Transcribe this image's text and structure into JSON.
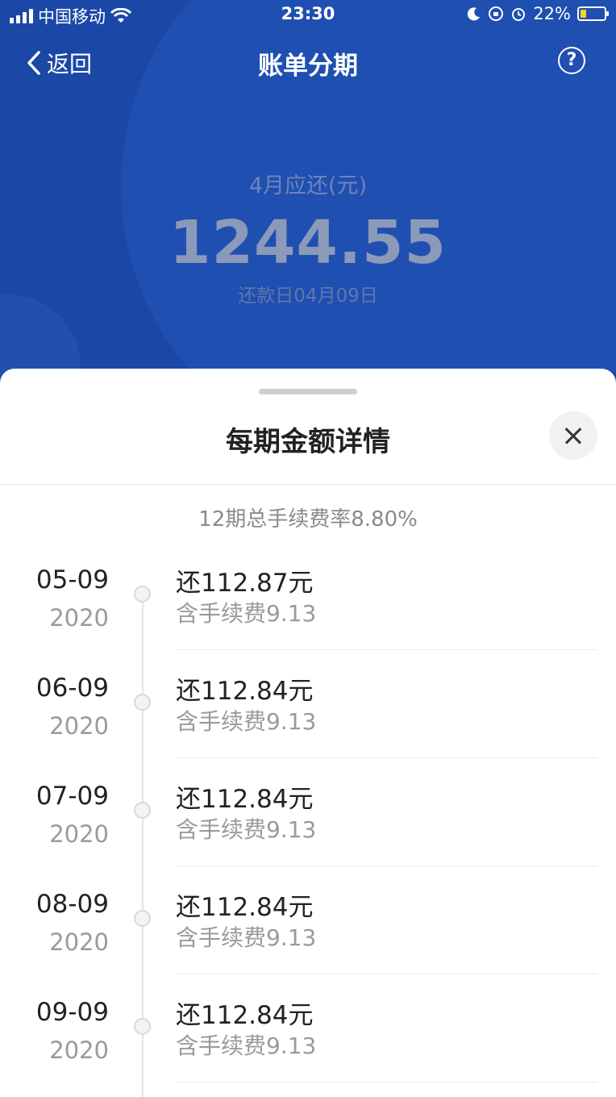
{
  "status_bar": {
    "carrier": "中国移动",
    "time": "23:30",
    "battery": "22%"
  },
  "nav": {
    "back_label": "返回",
    "title": "账单分期",
    "help_icon": "question-circle-icon"
  },
  "summary": {
    "due_label": "4月应还(元)",
    "due_amount": "1244.55",
    "due_date": "还款日04月09日"
  },
  "sheet": {
    "title": "每期金额详情",
    "rate_text": "12期总手续费率8.80%",
    "installments": [
      {
        "date": "05-09",
        "year": "2020",
        "amount": "还112.87元",
        "fee": "含手续费9.13"
      },
      {
        "date": "06-09",
        "year": "2020",
        "amount": "还112.84元",
        "fee": "含手续费9.13"
      },
      {
        "date": "07-09",
        "year": "2020",
        "amount": "还112.84元",
        "fee": "含手续费9.13"
      },
      {
        "date": "08-09",
        "year": "2020",
        "amount": "还112.84元",
        "fee": "含手续费9.13"
      },
      {
        "date": "09-09",
        "year": "2020",
        "amount": "还112.84元",
        "fee": "含手续费9.13"
      }
    ]
  }
}
